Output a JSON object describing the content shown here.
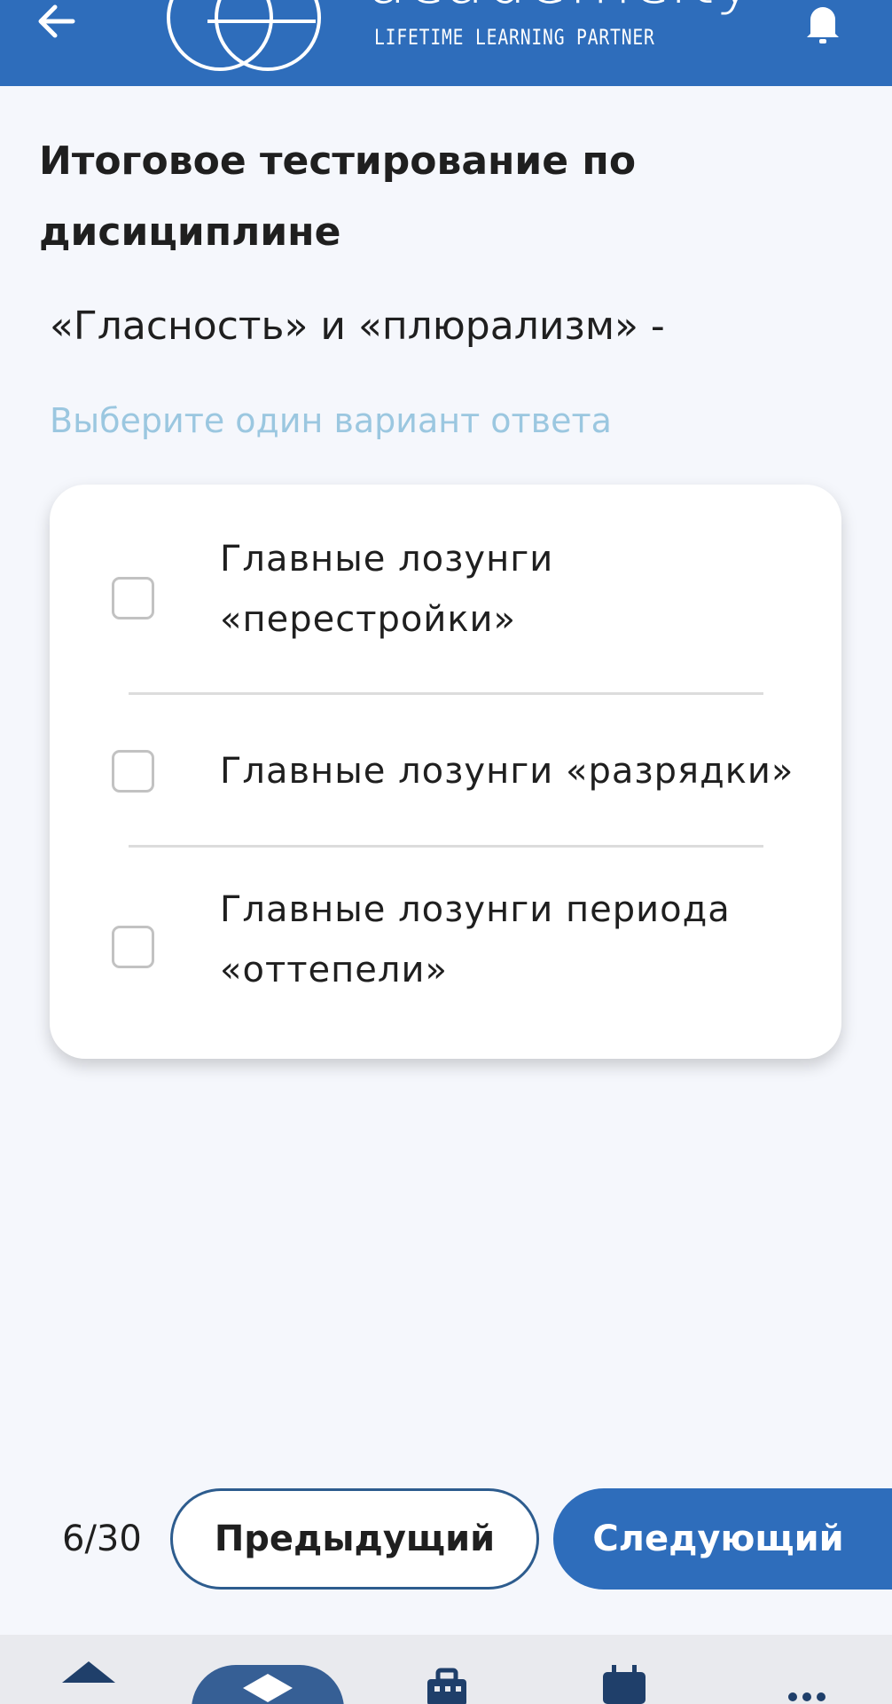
{
  "header": {
    "back_icon": "arrow-left-icon",
    "logo_word": "academcity",
    "logo_tagline": "LIFETIME LEARNING PARTNER",
    "bell_icon": "bell-icon",
    "background_color": "#2e6dbb"
  },
  "page": {
    "title": "Итоговое тестирование по дисициплине",
    "question": "«Гласность» и «плюрализм» -",
    "hint": "Выберите один вариант ответа"
  },
  "options": [
    {
      "label": "Главные лозунги «перестройки»",
      "checked": false
    },
    {
      "label": "Главные лозунги «разрядки»",
      "checked": false
    },
    {
      "label": "Главные лозунги периода «оттепели»",
      "checked": false
    }
  ],
  "footer": {
    "counter": "6/30",
    "prev_label": "Предыдущий",
    "next_label": "Следующий",
    "accent_color": "#2e6dbb"
  },
  "bottom_nav": {
    "items": [
      {
        "icon": "home-icon"
      },
      {
        "icon": "graduation-cap-icon",
        "active": true
      },
      {
        "icon": "briefcase-icon"
      },
      {
        "icon": "calendar-icon"
      },
      {
        "icon": "more-dots-icon"
      }
    ]
  }
}
